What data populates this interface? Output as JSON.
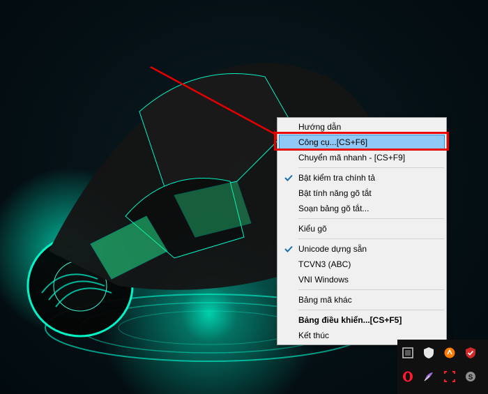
{
  "menu": {
    "items": [
      {
        "label": "Hướng dẫn",
        "checked": false,
        "highlight": false,
        "bold": false
      },
      {
        "label": "Công cụ...[CS+F6]",
        "checked": false,
        "highlight": true,
        "bold": false
      },
      {
        "label": "Chuyển mã nhanh - [CS+F9]",
        "checked": false,
        "highlight": false,
        "bold": false
      }
    ],
    "group2": [
      {
        "label": "Bật kiểm tra chính tả",
        "checked": true,
        "highlight": false,
        "bold": false
      },
      {
        "label": "Bật tính năng gõ tắt",
        "checked": false,
        "highlight": false,
        "bold": false
      },
      {
        "label": "Soạn bảng gõ tắt...",
        "checked": false,
        "highlight": false,
        "bold": false
      }
    ],
    "group3": [
      {
        "label": "Kiểu gõ",
        "checked": false,
        "highlight": false,
        "bold": false
      }
    ],
    "group4": [
      {
        "label": "Unicode dựng sẵn",
        "checked": true,
        "highlight": false,
        "bold": false
      },
      {
        "label": "TCVN3 (ABC)",
        "checked": false,
        "highlight": false,
        "bold": false
      },
      {
        "label": "VNI Windows",
        "checked": false,
        "highlight": false,
        "bold": false
      }
    ],
    "group5": [
      {
        "label": "Bảng mã khác",
        "checked": false,
        "highlight": false,
        "bold": false
      }
    ],
    "group6": [
      {
        "label": "Bảng điều khiển...[CS+F5]",
        "checked": false,
        "highlight": false,
        "bold": true
      },
      {
        "label": "Kết thúc",
        "checked": false,
        "highlight": false,
        "bold": false
      }
    ]
  },
  "tray": {
    "icons": [
      {
        "name": "windows-defender-icon",
        "color": "#ffffff"
      },
      {
        "name": "avast-icon",
        "color": "#ff7a00"
      },
      {
        "name": "checkmark-icon",
        "color": "#d02828"
      },
      {
        "name": "opera-icon",
        "color": "#ff1b2d"
      },
      {
        "name": "feather-icon",
        "color": "#9b6fd8"
      },
      {
        "name": "focus-frame-icon",
        "color": "#ff1b2d"
      },
      {
        "name": "skype-icon",
        "color": "#8f8f8f"
      }
    ]
  }
}
